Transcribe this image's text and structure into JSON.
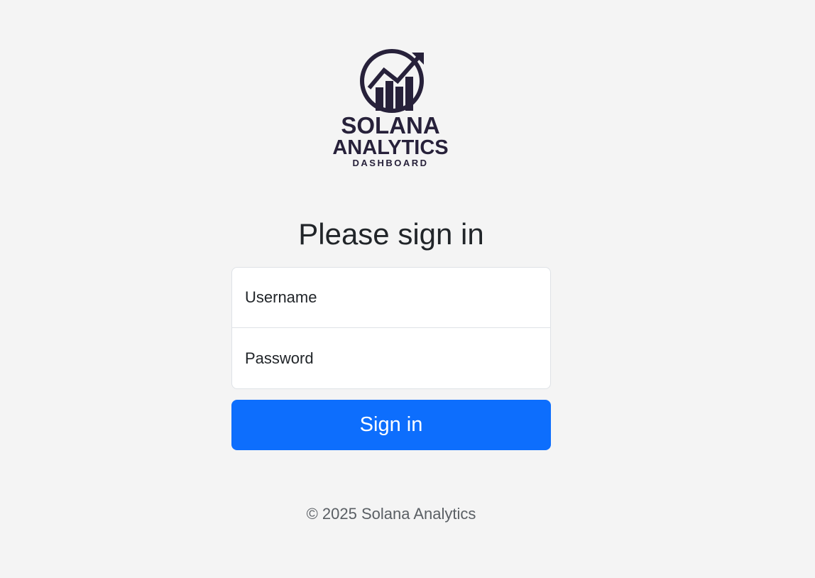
{
  "logo": {
    "line1": "SOLANA",
    "line2": "ANALYTICS",
    "line3": "DASHBOARD",
    "icon": "chart-growth-icon",
    "color": "#27213a"
  },
  "heading": "Please sign in",
  "form": {
    "username_placeholder": "Username",
    "username_value": "",
    "password_placeholder": "Password",
    "password_value": ""
  },
  "submit_label": "Sign in",
  "footer": "© 2025 Solana Analytics",
  "colors": {
    "background": "#f4f4f4",
    "primary": "#0d6efd",
    "logo": "#27213a"
  }
}
